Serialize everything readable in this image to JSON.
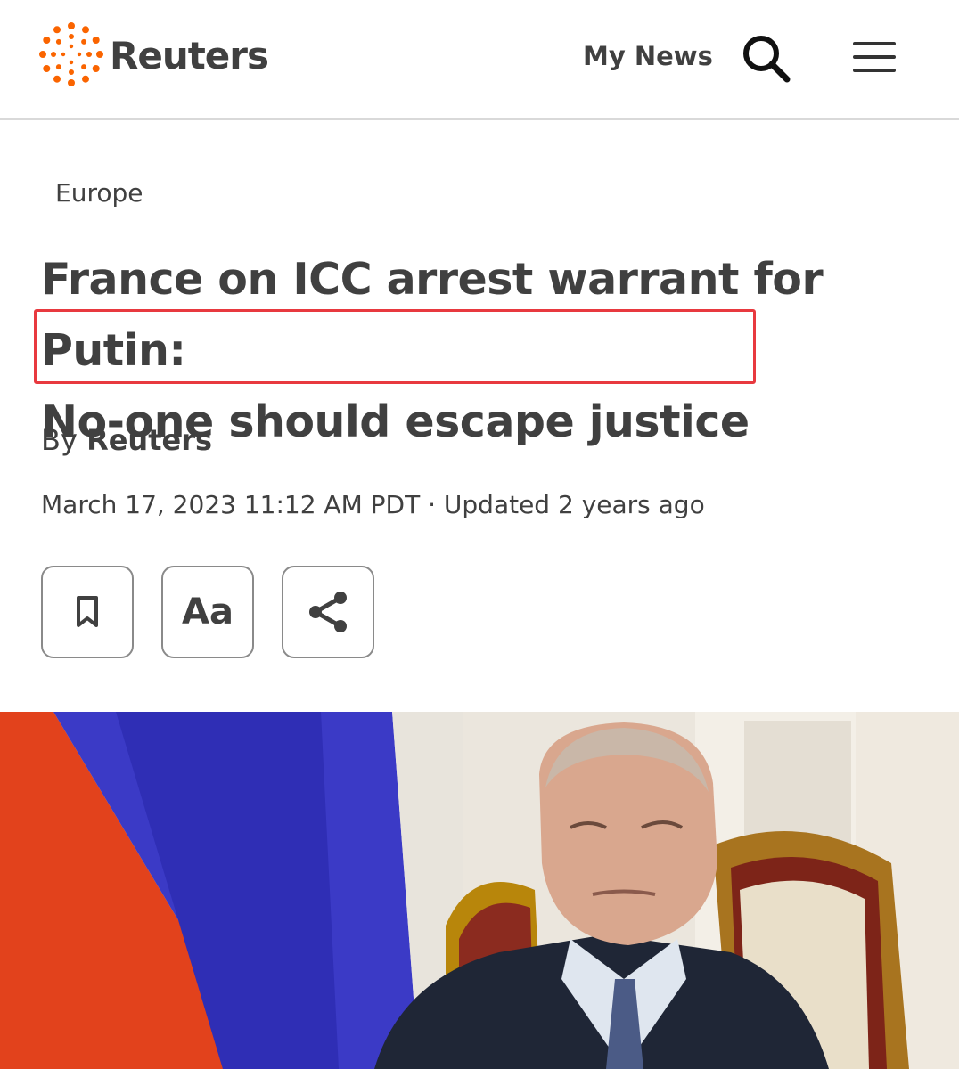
{
  "header": {
    "brand": "Reuters",
    "my_news_label": "My News",
    "search_icon": "search-icon",
    "menu_icon": "hamburger-menu-icon",
    "accent_color": "#fa6400"
  },
  "article": {
    "category": "Europe",
    "headline_line1": "France on ICC arrest warrant for Putin:",
    "headline_line2": "No-one should escape justice",
    "highlight_color": "#e8393f",
    "byline_prefix": "By",
    "byline_author": "Reuters",
    "dateline": "March 17, 2023 11:12 AM PDT · Updated 2 years ago"
  },
  "toolbar": {
    "bookmark_icon": "bookmark-icon",
    "text_size_label": "Aa",
    "share_icon": "share-icon"
  }
}
